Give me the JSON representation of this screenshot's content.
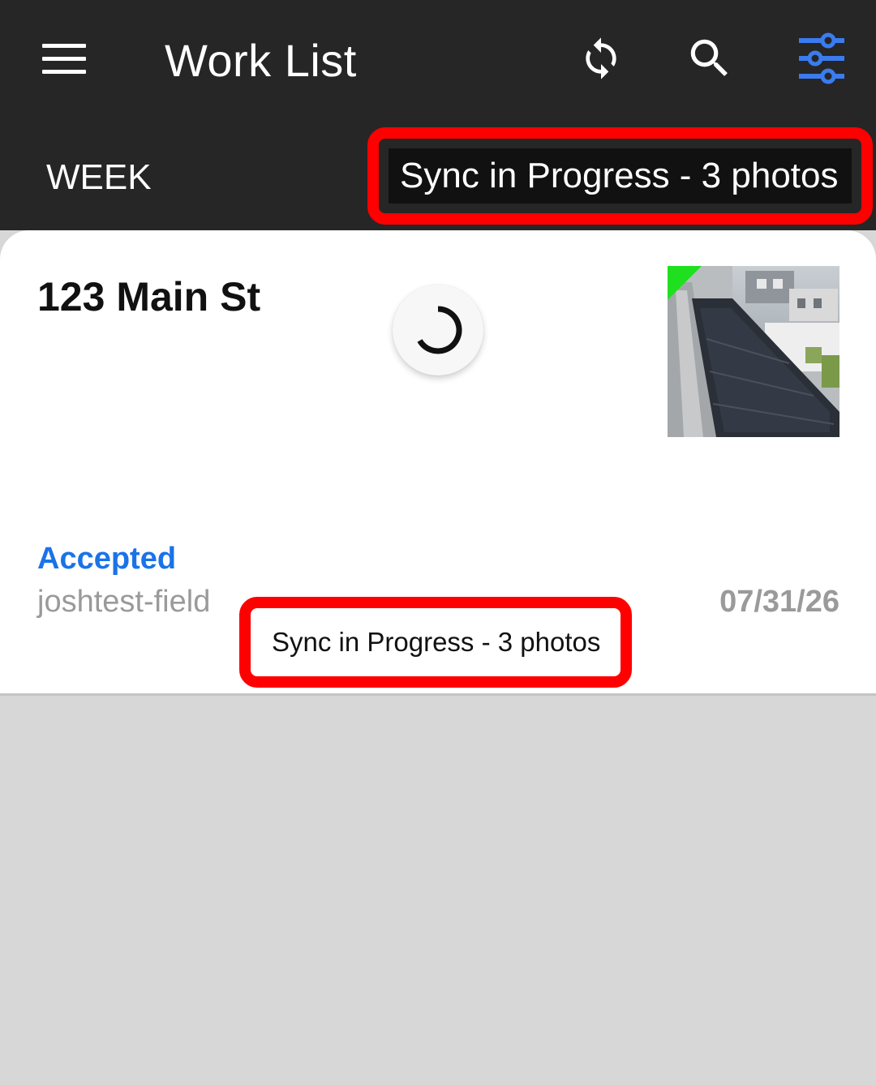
{
  "appbar": {
    "title": "Work List",
    "icons": [
      "menu-icon",
      "sync-icon",
      "search-icon",
      "filter-sliders-icon"
    ],
    "filter_icon_color": "#3a7cf0"
  },
  "tabs": {
    "week_label": "WEEK",
    "sync_status": "Sync in Progress - 3 photos"
  },
  "card": {
    "address": "123 Main St",
    "status": "Accepted",
    "status_color": "#1a73e8",
    "assignee": "joshtest-field",
    "date": "07/31/26",
    "sync_status": "Sync in Progress - 3 photos",
    "thumbnail_badge_color": "#1fe01f"
  },
  "colors": {
    "appbar_bg": "#262626",
    "highlight_outline": "#ff0000",
    "page_bg": "#d7d7d7"
  }
}
